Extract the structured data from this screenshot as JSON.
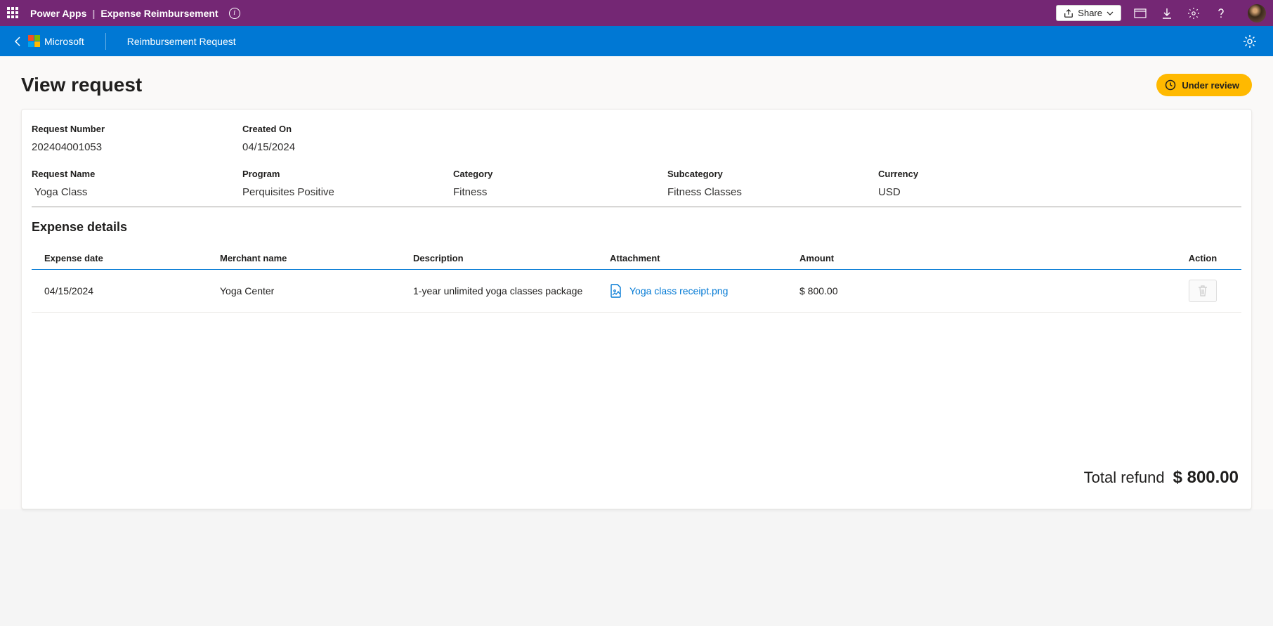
{
  "topbar": {
    "product": "Power Apps",
    "app": "Expense Reimbursement",
    "share_label": "Share"
  },
  "appbar": {
    "company": "Microsoft",
    "title": "Reimbursement Request"
  },
  "page": {
    "title": "View request"
  },
  "status": {
    "label": "Under review"
  },
  "summary": {
    "request_number_label": "Request Number",
    "request_number": "202404001053",
    "created_on_label": "Created On",
    "created_on": "04/15/2024",
    "request_name_label": "Request Name",
    "request_name": "Yoga Class",
    "program_label": "Program",
    "program": "Perquisites Positive",
    "category_label": "Category",
    "category": "Fitness",
    "subcategory_label": "Subcategory",
    "subcategory": "Fitness Classes",
    "currency_label": "Currency",
    "currency": "USD"
  },
  "details": {
    "title": "Expense details",
    "columns": {
      "date": "Expense date",
      "merchant": "Merchant name",
      "description": "Description",
      "attachment": "Attachment",
      "amount": "Amount",
      "action": "Action"
    },
    "rows": [
      {
        "date": "04/15/2024",
        "merchant": "Yoga Center",
        "description": "1-year unlimited yoga classes package",
        "attachment": "Yoga class receipt.png",
        "amount": "$ 800.00"
      }
    ]
  },
  "total": {
    "label": "Total refund",
    "value": "$ 800.00"
  }
}
